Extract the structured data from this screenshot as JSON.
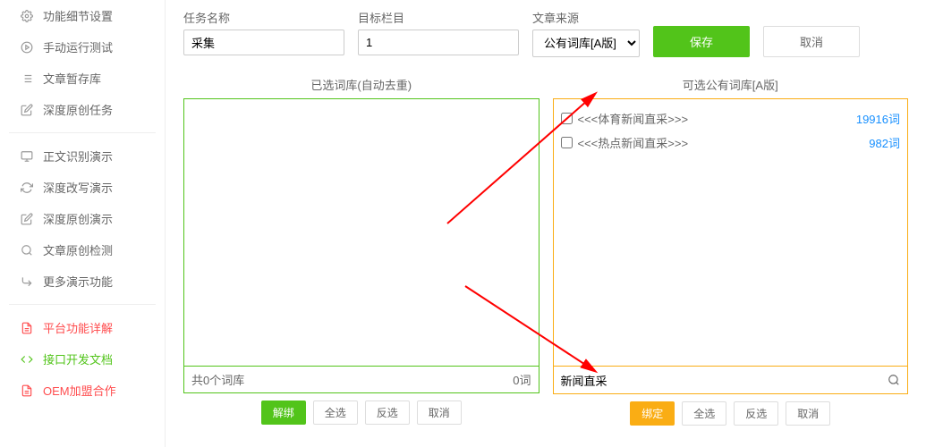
{
  "sidebar": {
    "group1": [
      {
        "label": "功能细节设置",
        "icon": "sliders"
      },
      {
        "label": "手动运行测试",
        "icon": "play-circle"
      },
      {
        "label": "文章暂存库",
        "icon": "list"
      },
      {
        "label": "深度原创任务",
        "icon": "edit"
      }
    ],
    "group2": [
      {
        "label": "正文识别演示",
        "icon": "monitor"
      },
      {
        "label": "深度改写演示",
        "icon": "refresh"
      },
      {
        "label": "深度原创演示",
        "icon": "edit"
      },
      {
        "label": "文章原创检测",
        "icon": "search"
      },
      {
        "label": "更多演示功能",
        "icon": "arrow-right"
      }
    ],
    "group3": [
      {
        "label": "平台功能详解",
        "icon": "file",
        "color": "red"
      },
      {
        "label": "接口开发文档",
        "icon": "code",
        "color": "green"
      },
      {
        "label": "OEM加盟合作",
        "icon": "file",
        "color": "red"
      }
    ]
  },
  "form": {
    "task_name_label": "任务名称",
    "task_name_value": "采集",
    "target_column_label": "目标栏目",
    "target_column_value": "1",
    "article_source_label": "文章来源",
    "article_source_selected": "公有词库[A版]",
    "save_label": "保存",
    "cancel_label": "取消"
  },
  "left_panel": {
    "title": "已选词库(自动去重)",
    "footer_label": "共0个词库",
    "footer_count": "0词",
    "unbind": "解绑",
    "select_all": "全选",
    "invert": "反选",
    "cancel": "取消"
  },
  "right_panel": {
    "title": "可选公有词库[A版]",
    "items": [
      {
        "label": "<<<体育新闻直采>>>",
        "count": "19916词"
      },
      {
        "label": "<<<热点新闻直采>>>",
        "count": "982词"
      }
    ],
    "search_value": "新闻直采",
    "bind": "绑定",
    "select_all": "全选",
    "invert": "反选",
    "cancel": "取消"
  }
}
